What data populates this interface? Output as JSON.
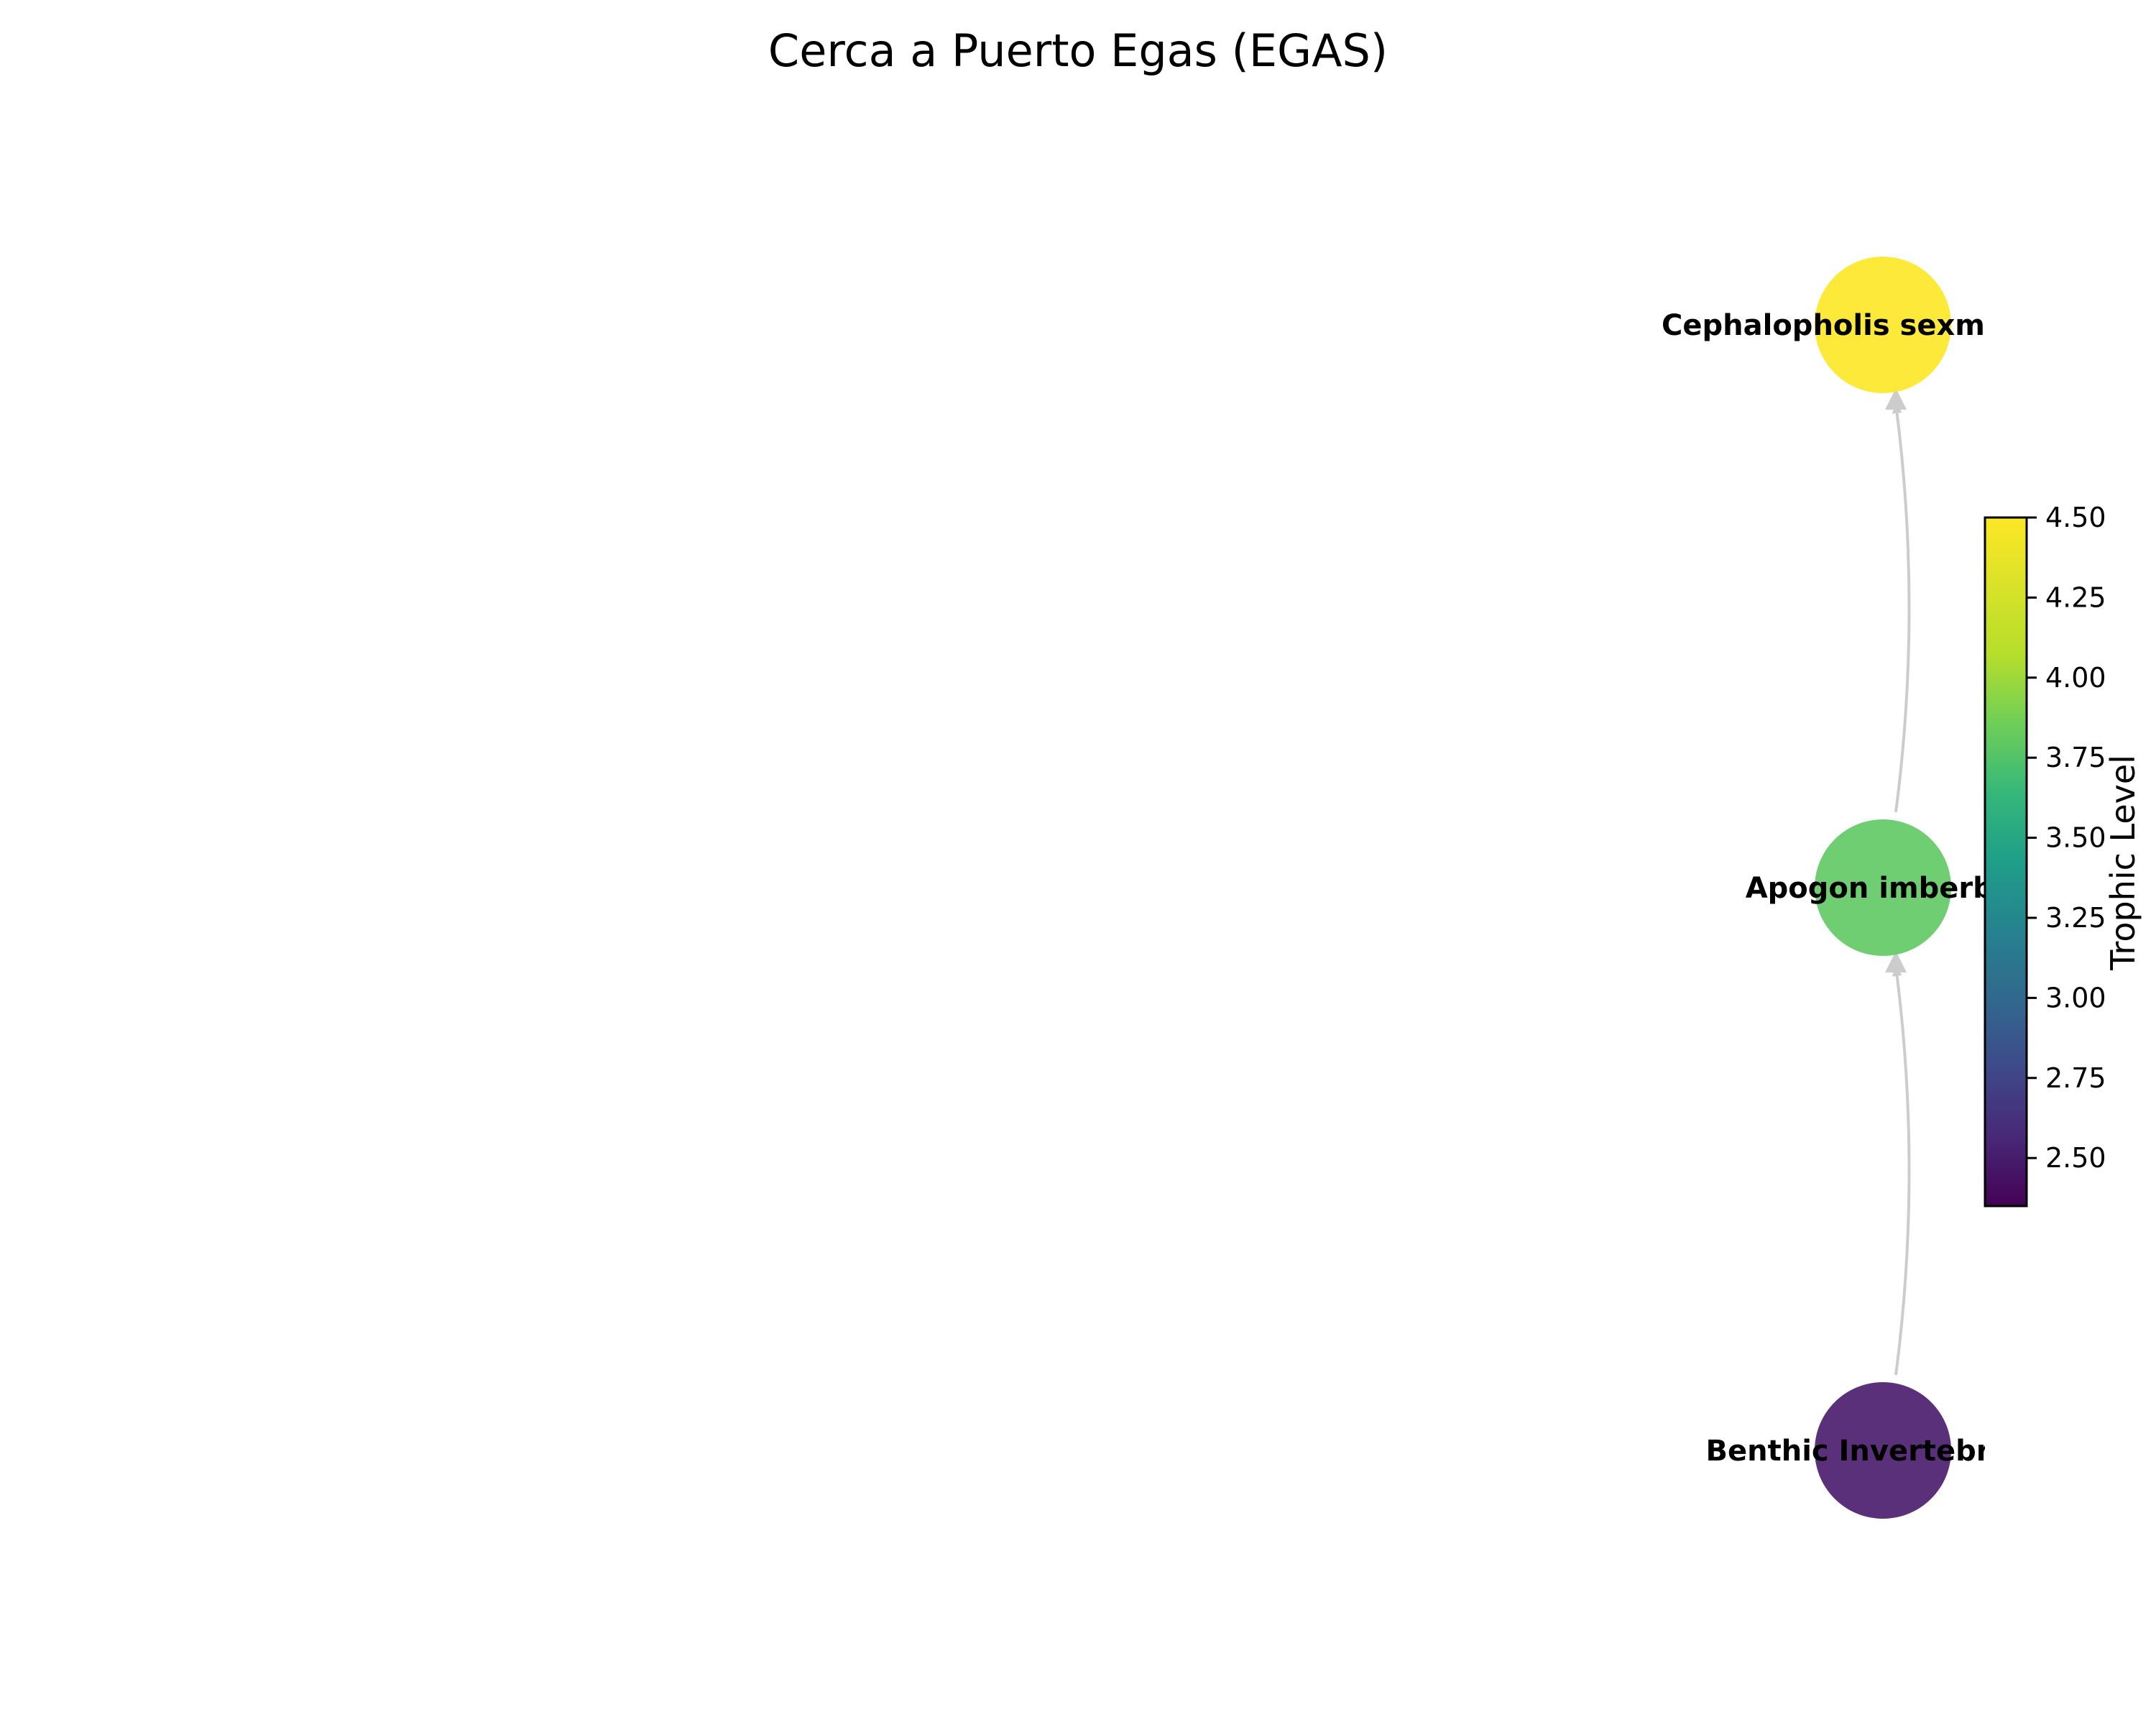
{
  "title": "Cerca a Puerto Egas (EGAS)",
  "nodes": [
    {
      "id": "cephalopholis",
      "label": "Cephalopholis sexmaculata",
      "trophic_level": 4.5,
      "color": "#fde725"
    },
    {
      "id": "apogon",
      "label": "Apogon imberbis",
      "trophic_level": 3.95,
      "color": "#5ec962"
    },
    {
      "id": "benthic",
      "label": "Benthic Invertebrates",
      "trophic_level": 2.4,
      "color": "#481a6c"
    }
  ],
  "edges": [
    {
      "from": "benthic",
      "to": "apogon",
      "color": "#cccccc"
    },
    {
      "from": "apogon",
      "to": "cephalopholis",
      "color": "#cccccc"
    }
  ],
  "colorbar": {
    "label": "Trophic Level",
    "colormap": "viridis",
    "range": [
      2.35,
      4.5
    ],
    "ticks": [
      "2.50",
      "2.75",
      "3.00",
      "3.25",
      "3.50",
      "3.75",
      "4.00",
      "4.25",
      "4.50"
    ]
  }
}
